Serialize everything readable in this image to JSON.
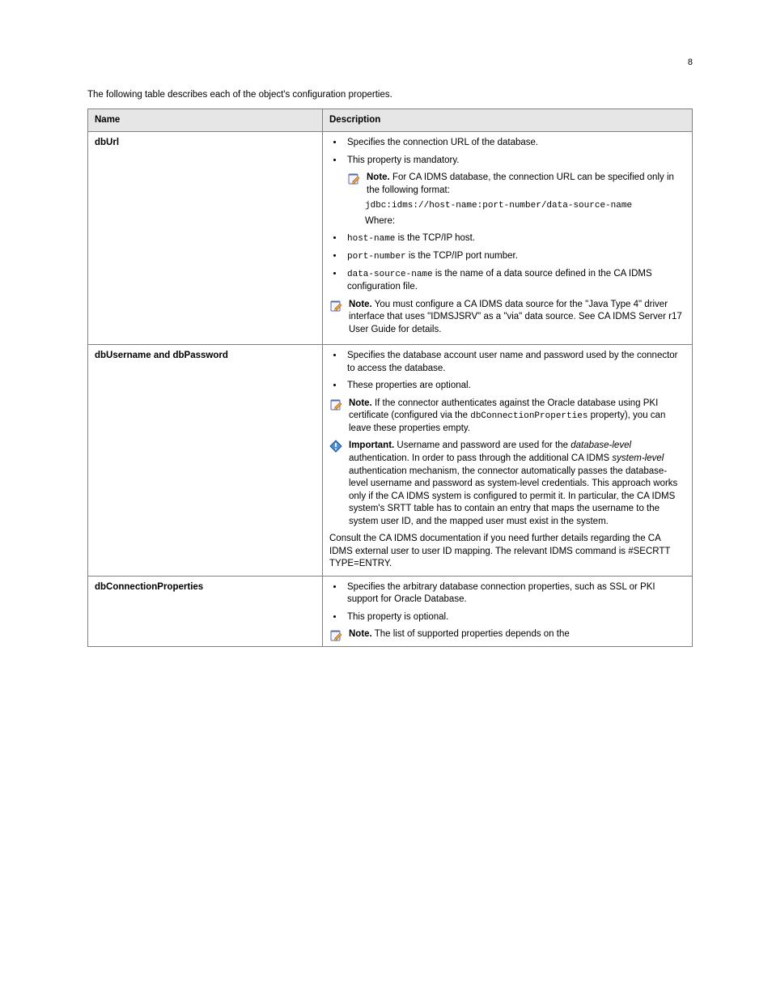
{
  "page_number": "8",
  "intro": "The following table describes each of the object's configuration properties.",
  "columns": {
    "c1": "Name",
    "c2": "Description"
  },
  "rows": [
    {
      "label": "dbUrl",
      "bullets": [
        "Specifies the connection URL of the database.",
        "This property is mandatory."
      ],
      "note1": {
        "lead": "Note.",
        "text": " For CA IDMS database, the connection URL can be specified only in the following format:"
      },
      "code": "jdbc:idms://host-name:port-number/data-source-name",
      "code_after": "Where:",
      "bullets2": [
        {
          "mono": "host-name",
          "rest": " is the TCP/IP host."
        },
        {
          "mono": "port-number",
          "rest": " is the TCP/IP port number."
        },
        {
          "mono": "data-source-name",
          "rest": " is the name of a data source defined in the CA IDMS configuration file."
        }
      ],
      "note2": {
        "lead": "Note.",
        "text": " You must configure a CA IDMS data source for the \"Java Type 4\" driver interface that uses \"IDMSJSRV\" as a \"via\" data source. See CA IDMS Server r17 User Guide for details."
      }
    },
    {
      "label": "dbUsername and dbPassword",
      "bullets": [
        "Specifies the database account user name and password used by the connector to access the database.",
        "These properties are optional."
      ],
      "note1": {
        "lead": "Note.",
        "text": " If the connector authenticates against the Oracle database using PKI certificate (configured via the "
      },
      "note1_extra": {
        "mono": "dbConnectionProperties",
        "rest": " property), you can leave these properties empty."
      },
      "important": {
        "lead": "Important.",
        "text_1": " Username and password are used for the ",
        "i1": "database-level",
        "text_2": " authentication. In order to pass through the additional CA IDMS ",
        "i2": "system-level",
        "text_3": " authentication mechanism, the connector automatically passes the database-level username and password as system-level credentials. This approach works only if the CA IDMS system is configured to permit it. In particular, the CA IDMS system's SRTT table has to contain an entry that maps the username to the system user ID, and the mapped user must exist in the system."
      },
      "tail": "Consult the CA IDMS documentation if you need further details regarding the CA IDMS external user to user ID mapping. The relevant IDMS command is #SECRTT TYPE=ENTRY."
    },
    {
      "label": "dbConnectionProperties",
      "bullets": [
        "Specifies the arbitrary database connection properties, such as SSL or PKI support for Oracle Database.",
        "This property is optional."
      ],
      "note_basic": {
        "lead": "Note.",
        "text": " The list of supported properties depends on the"
      }
    }
  ]
}
